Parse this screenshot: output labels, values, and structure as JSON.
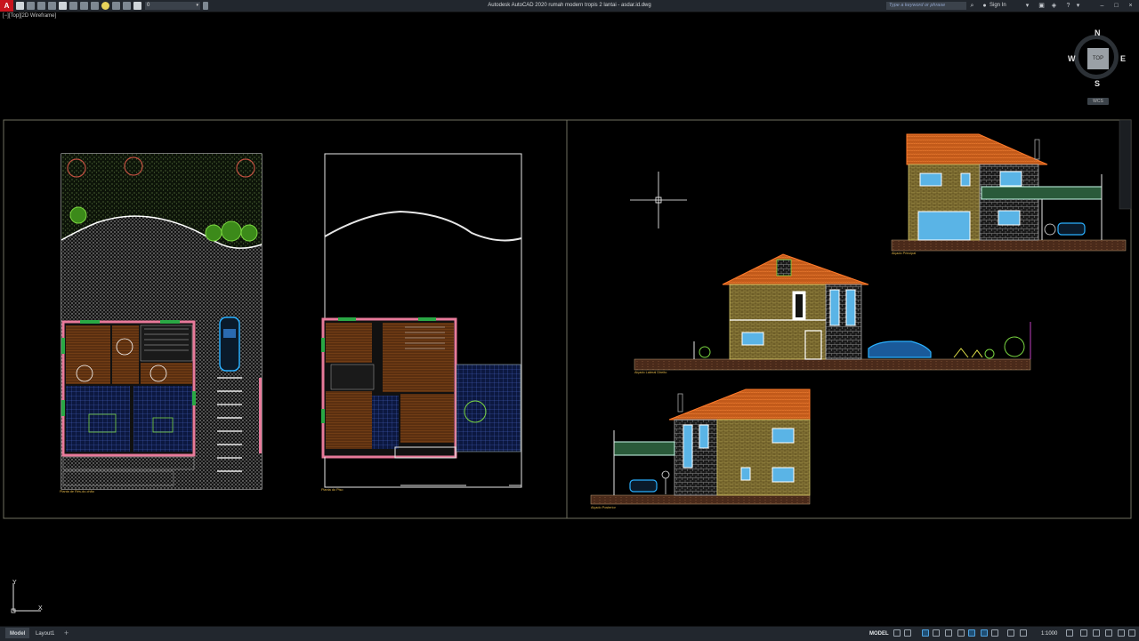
{
  "titlebar": {
    "app_button": "A",
    "layer_value": "0",
    "title": "Autodesk AutoCAD 2020    rumah modern tropis 2 lantai - asdar.id.dwg",
    "search_placeholder": "Type a keyword or phrase",
    "sign_in": "Sign In"
  },
  "viewport": {
    "label": "[−][Top][2D Wireframe]"
  },
  "viewcube": {
    "top_label": "TOP",
    "north": "N",
    "south": "S",
    "east": "E",
    "west": "W",
    "wcs": "WCS"
  },
  "drawing": {
    "ground_floor_label": "Planta de Rés-do-chão",
    "first_floor_label": "Planta do Piso",
    "elevation1_label": "Alçado Principal",
    "elevation2_label": "Alçado Lateral Direito",
    "elevation3_label": "Alçado Posterior"
  },
  "ucs": {
    "x": "X",
    "y": "Y"
  },
  "statusbar": {
    "tab_model": "Model",
    "tab_layout": "Layout1",
    "tab_add": "+",
    "model_indicator": "MODEL",
    "scale": "1:1000"
  }
}
